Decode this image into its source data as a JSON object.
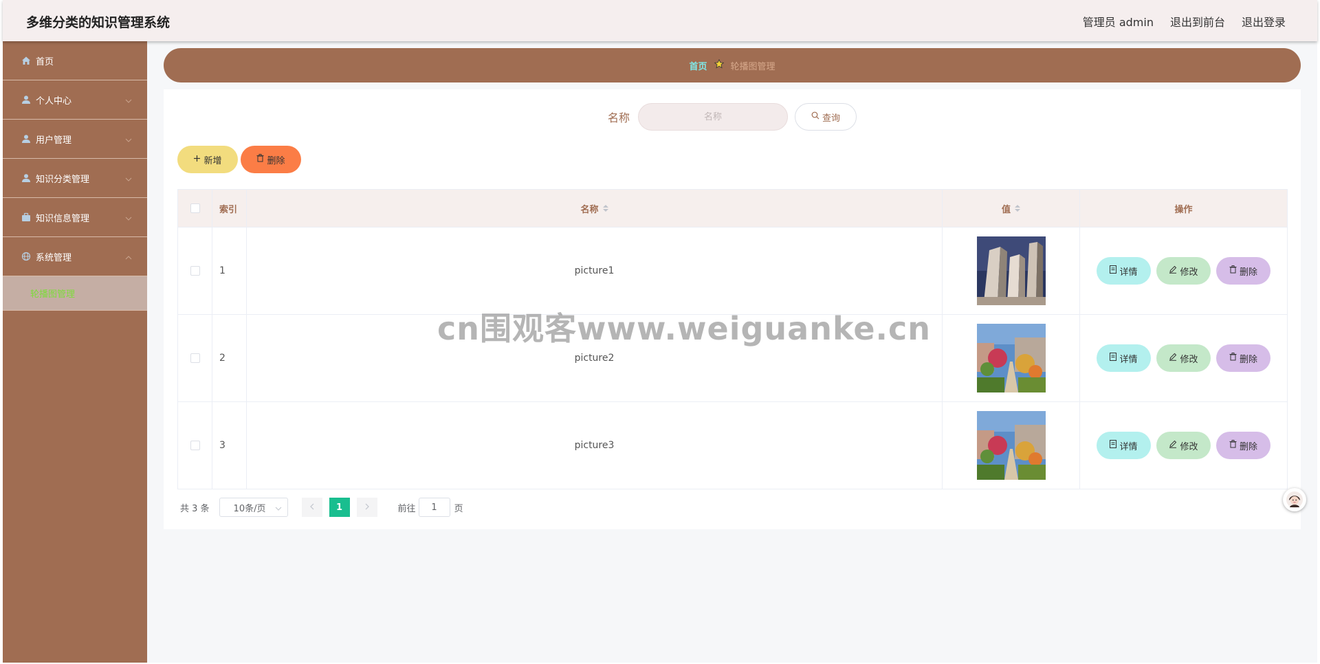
{
  "app": {
    "title": "多维分类的知识管理系统"
  },
  "header": {
    "user": "管理员 admin",
    "to_front": "退出到前台",
    "logout": "退出登录"
  },
  "sidebar": {
    "items": [
      {
        "label": "首页",
        "icon": "home-icon"
      },
      {
        "label": "个人中心",
        "icon": "user-icon"
      },
      {
        "label": "用户管理",
        "icon": "user-icon"
      },
      {
        "label": "知识分类管理",
        "icon": "user-icon"
      },
      {
        "label": "知识信息管理",
        "icon": "briefcase-icon"
      },
      {
        "label": "系统管理",
        "icon": "globe-icon"
      }
    ],
    "sub_item": "轮播图管理"
  },
  "breadcrumb": {
    "home": "首页",
    "current": "轮播图管理"
  },
  "search": {
    "label": "名称",
    "placeholder": "名称",
    "button": "查询"
  },
  "toolbar": {
    "add": "新增",
    "delete": "删除"
  },
  "table": {
    "headers": {
      "index": "索引",
      "name": "名称",
      "value": "值",
      "ops": "操作"
    },
    "rows": [
      {
        "index": "1",
        "name": "picture1"
      },
      {
        "index": "2",
        "name": "picture2"
      },
      {
        "index": "3",
        "name": "picture3"
      }
    ],
    "op_labels": {
      "detail": "详情",
      "edit": "修改",
      "delete": "删除"
    }
  },
  "pagination": {
    "total": "共 3 条",
    "page_size": "10条/页",
    "current": "1",
    "goto_label": "前往",
    "goto_value": "1",
    "page_suffix": "页"
  },
  "watermark": "cn围观客www.weiguanke.cn",
  "colors": {
    "sidebar": "#a06d52",
    "header": "#f5eeee",
    "accent": "#19be8f",
    "add": "#f2dc7e",
    "delete": "#fb7d46"
  }
}
